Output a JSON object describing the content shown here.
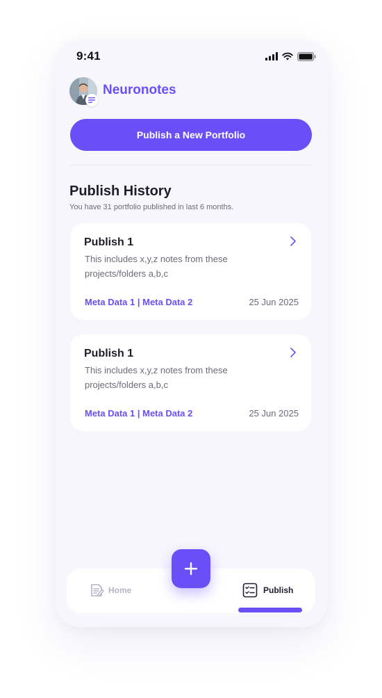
{
  "status_bar": {
    "time": "9:41",
    "icons": [
      "signal-icon",
      "wifi-icon",
      "battery-icon"
    ]
  },
  "header": {
    "app_name": "Neuronotes",
    "avatar_badge_icon": "notes-icon"
  },
  "actions": {
    "publish_new_label": "Publish a New Portfolio"
  },
  "history": {
    "title": "Publish History",
    "subtitle": "You have 31 portfolio published in last 6 months.",
    "items": [
      {
        "title": "Publish 1",
        "description": "This includes x,y,z notes from these projects/folders a,b,c",
        "meta": "Meta Data 1 | Meta Data 2",
        "date": "25 Jun 2025"
      },
      {
        "title": "Publish 1",
        "description": "This includes x,y,z notes from these projects/folders a,b,c",
        "meta": "Meta Data 1 | Meta Data 2",
        "date": "25 Jun 2025"
      }
    ]
  },
  "nav": {
    "home_label": "Home",
    "publish_label": "Publish",
    "active": "Publish",
    "fab_icon": "plus-icon"
  },
  "colors": {
    "accent": "#6a4ff7",
    "background": "#f7f6fd",
    "card": "#ffffff",
    "muted_text": "#6b6b7a",
    "inactive_nav": "#b4b3c6"
  }
}
